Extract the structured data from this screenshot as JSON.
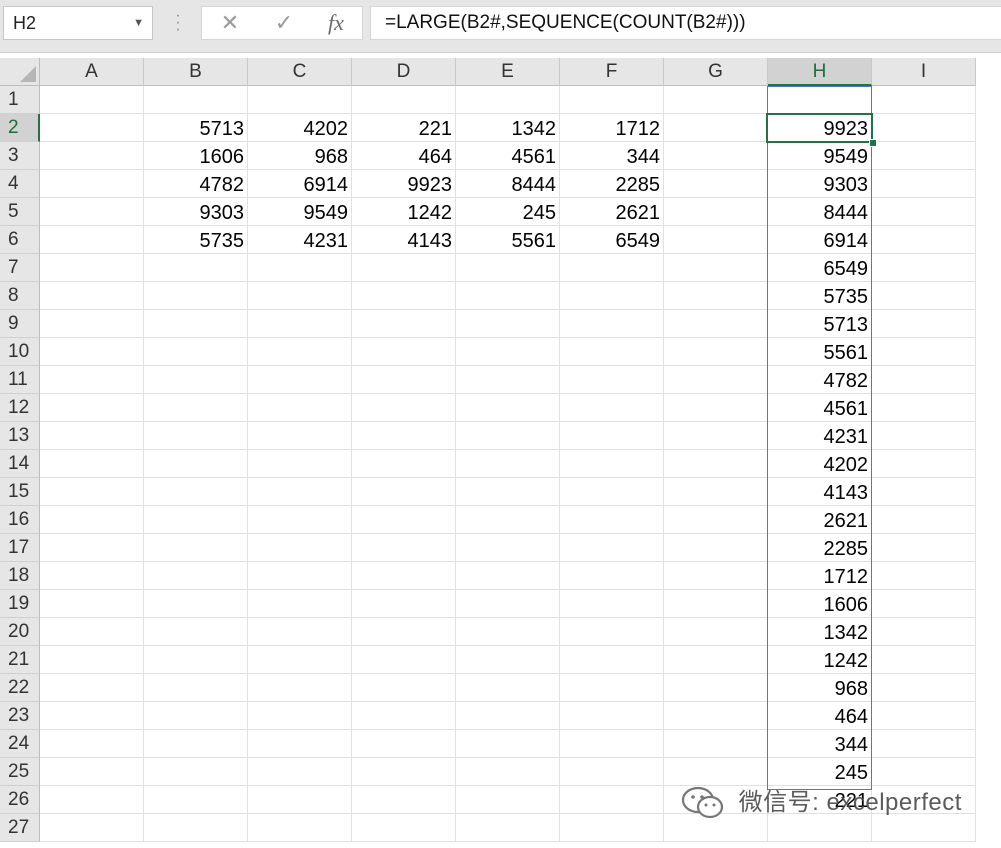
{
  "name_box": "H2",
  "formula": "=LARGE(B2#,SEQUENCE(COUNT(B2#)))",
  "formula_buttons": {
    "cancel": "✕",
    "enter": "✓",
    "fx": "fx"
  },
  "columns": [
    "A",
    "B",
    "C",
    "D",
    "E",
    "F",
    "G",
    "H",
    "I"
  ],
  "active_column": "H",
  "active_row": 2,
  "rows": [
    {
      "n": "1",
      "B": "",
      "C": "",
      "D": "",
      "E": "",
      "F": "",
      "H": ""
    },
    {
      "n": "2",
      "B": "5713",
      "C": "4202",
      "D": "221",
      "E": "1342",
      "F": "1712",
      "H": "9923"
    },
    {
      "n": "3",
      "B": "1606",
      "C": "968",
      "D": "464",
      "E": "4561",
      "F": "344",
      "H": "9549"
    },
    {
      "n": "4",
      "B": "4782",
      "C": "6914",
      "D": "9923",
      "E": "8444",
      "F": "2285",
      "H": "9303"
    },
    {
      "n": "5",
      "B": "9303",
      "C": "9549",
      "D": "1242",
      "E": "245",
      "F": "2621",
      "H": "8444"
    },
    {
      "n": "6",
      "B": "5735",
      "C": "4231",
      "D": "4143",
      "E": "5561",
      "F": "6549",
      "H": "6914"
    },
    {
      "n": "7",
      "H": "6549"
    },
    {
      "n": "8",
      "H": "5735"
    },
    {
      "n": "9",
      "H": "5713"
    },
    {
      "n": "10",
      "H": "5561"
    },
    {
      "n": "11",
      "H": "4782"
    },
    {
      "n": "12",
      "H": "4561"
    },
    {
      "n": "13",
      "H": "4231"
    },
    {
      "n": "14",
      "H": "4202"
    },
    {
      "n": "15",
      "H": "4143"
    },
    {
      "n": "16",
      "H": "2621"
    },
    {
      "n": "17",
      "H": "2285"
    },
    {
      "n": "18",
      "H": "1712"
    },
    {
      "n": "19",
      "H": "1606"
    },
    {
      "n": "20",
      "H": "1342"
    },
    {
      "n": "21",
      "H": "1242"
    },
    {
      "n": "22",
      "H": "968"
    },
    {
      "n": "23",
      "H": "464"
    },
    {
      "n": "24",
      "H": "344"
    },
    {
      "n": "25",
      "H": "245"
    },
    {
      "n": "26",
      "H": "221"
    },
    {
      "n": "27",
      "H": ""
    }
  ],
  "watermark": "微信号: excelperfect",
  "colors": {
    "accent": "#217346",
    "spill_border": "#4a7ebb",
    "header_bg": "#e6e6e6"
  }
}
